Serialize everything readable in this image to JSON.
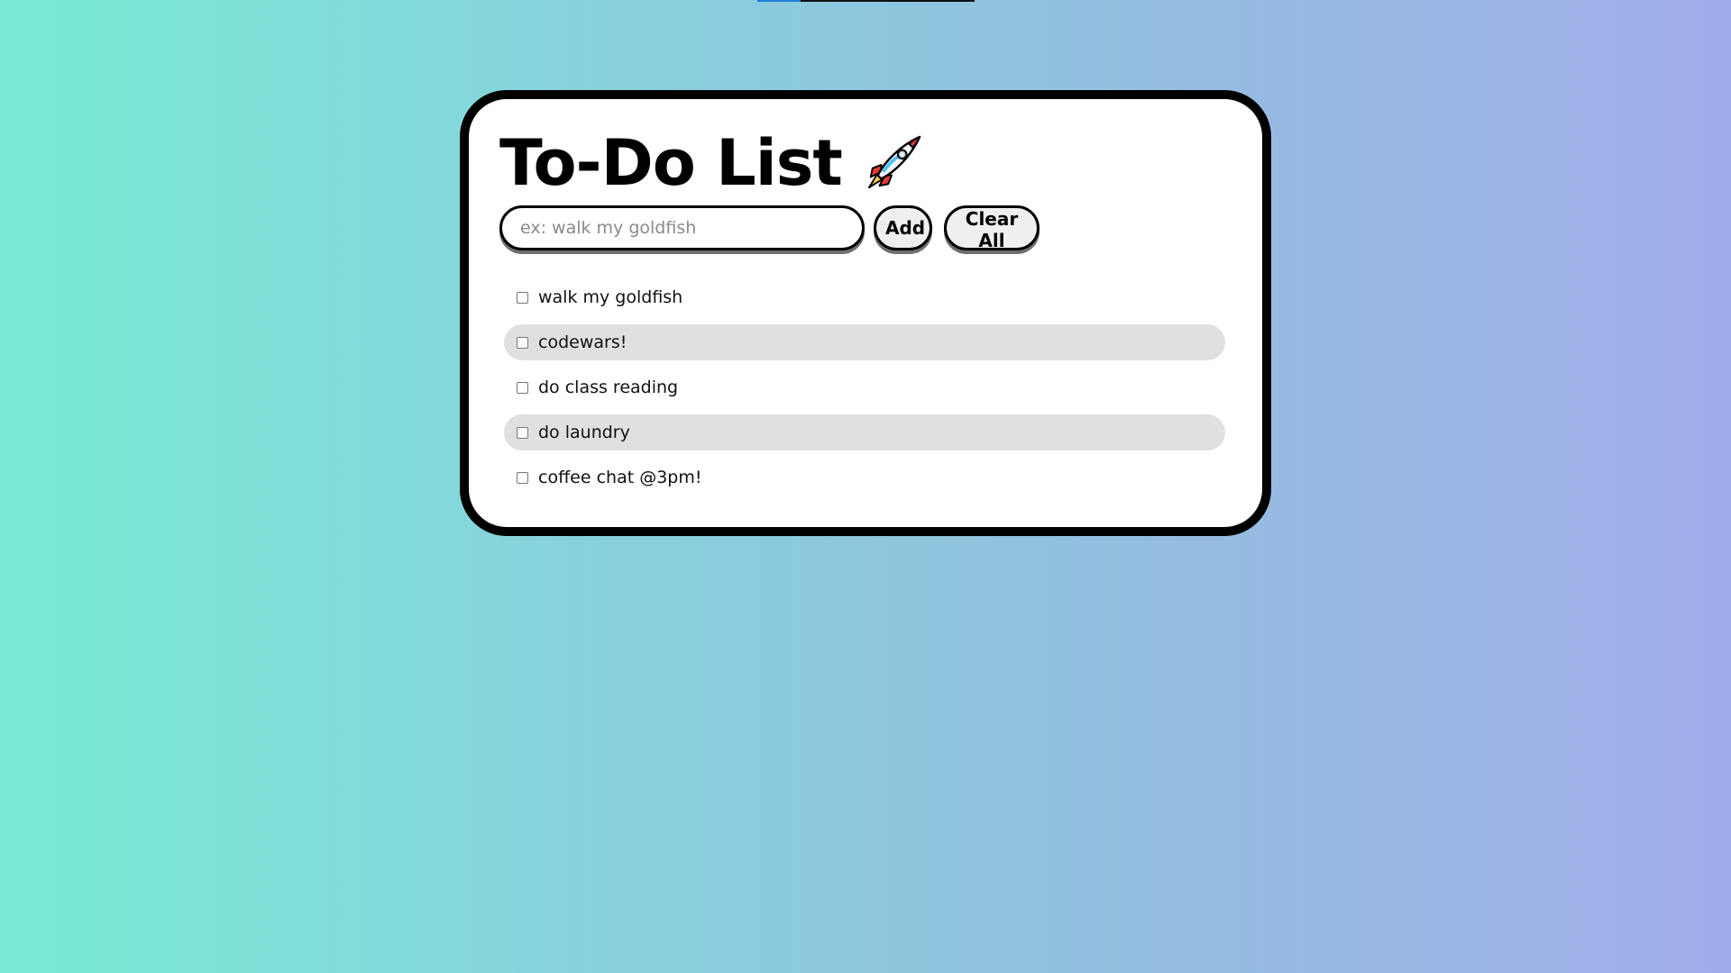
{
  "app": {
    "title": "To-Do List",
    "title_icon": "rocket-icon"
  },
  "form": {
    "input_value": "",
    "input_placeholder": "ex: walk my goldfish",
    "add_label": "Add",
    "clear_label": "Clear All"
  },
  "todos": [
    {
      "text": "walk my goldfish",
      "checked": false,
      "shaded": false
    },
    {
      "text": "codewars!",
      "checked": false,
      "shaded": true
    },
    {
      "text": "do class reading",
      "checked": false,
      "shaded": false
    },
    {
      "text": "do laundry",
      "checked": false,
      "shaded": true
    },
    {
      "text": "coffee chat @3pm!",
      "checked": false,
      "shaded": false
    }
  ],
  "colors": {
    "gradient_start": "#79ebd6",
    "gradient_end": "#a0acea",
    "card_border": "#000000",
    "shaded_row": "#e0e0e0",
    "button_bg": "#efefef"
  }
}
